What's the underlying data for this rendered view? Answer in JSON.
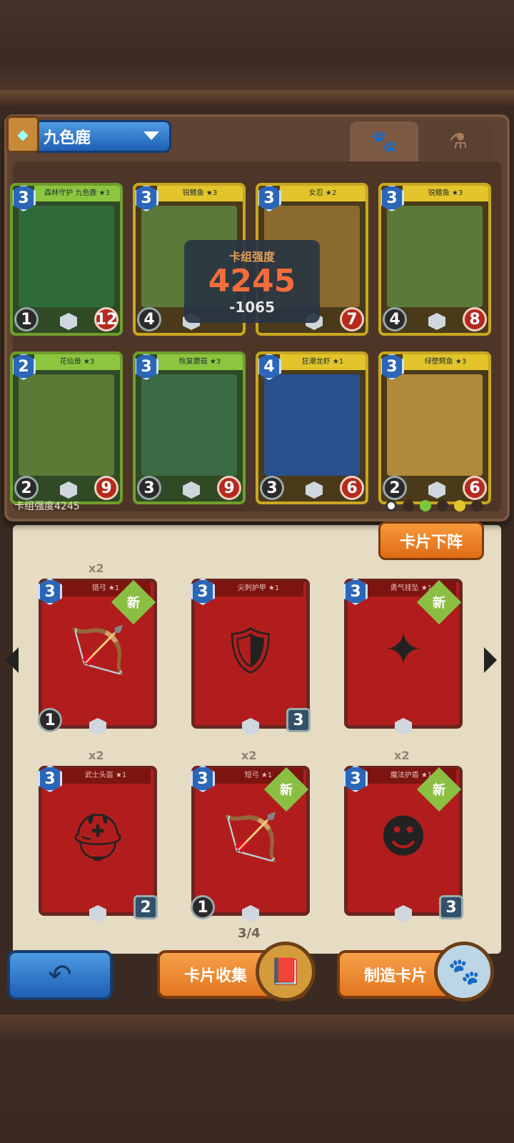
{
  "deck": {
    "name": "九色鹿",
    "power_footer": "卡组强度4245",
    "power_popup": {
      "label": "卡组强度",
      "value": "4245",
      "delta": "-1065"
    }
  },
  "tabs": [
    "paw-icon",
    "potion-icon"
  ],
  "deck_cards": [
    {
      "title": "森林守护 九色鹿 ★3",
      "cost": "3",
      "attack": "1",
      "health": "12",
      "frame": "green",
      "art": "#2f6b3a"
    },
    {
      "title": "锐鳍鱼 ★3",
      "cost": "3",
      "attack": "4",
      "health": "",
      "frame": "gold",
      "art": "#5b7a3a"
    },
    {
      "title": "女忍 ★2",
      "cost": "3",
      "attack": "",
      "health": "7",
      "frame": "gold",
      "art": "#8a6a2e"
    },
    {
      "title": "锐鳍鱼 ★3",
      "cost": "3",
      "attack": "4",
      "health": "8",
      "frame": "gold",
      "art": "#5b7a3a"
    },
    {
      "title": "花仙兽 ★3",
      "cost": "2",
      "attack": "2",
      "health": "9",
      "frame": "green",
      "art": "#5a7a35"
    },
    {
      "title": "恢复蘑菇 ★3",
      "cost": "3",
      "attack": "3",
      "health": "9",
      "frame": "green",
      "art": "#3b6a45"
    },
    {
      "title": "狂潮龙虾 ★1",
      "cost": "4",
      "attack": "3",
      "health": "6",
      "frame": "gold",
      "art": "#2a4f8f"
    },
    {
      "title": "绿壁鳄鱼 ★3",
      "cost": "3",
      "attack": "2",
      "health": "6",
      "frame": "gold",
      "art": "#b08a3a"
    }
  ],
  "remove_button": "卡片下阵",
  "collection_cards": [
    {
      "title": "猎弓 ★1",
      "cost": "3",
      "count": "x2",
      "new": "新",
      "attack": "1",
      "armor": "",
      "art_icon": "🏹"
    },
    {
      "title": "尖刺护甲 ★1",
      "cost": "3",
      "count": "",
      "new": "",
      "attack": "",
      "armor": "3",
      "art_icon": "🛡"
    },
    {
      "title": "勇气挂坠 ★1",
      "cost": "3",
      "count": "",
      "new": "新",
      "attack": "",
      "armor": "",
      "art_icon": "✦"
    },
    {
      "title": "武士头盔 ★1",
      "cost": "3",
      "count": "x2",
      "new": "",
      "attack": "",
      "armor": "2",
      "art_icon": "⛑"
    },
    {
      "title": "短弓 ★1",
      "cost": "3",
      "count": "x2",
      "new": "新",
      "attack": "1",
      "armor": "",
      "art_icon": "🏹"
    },
    {
      "title": "魔法护盾 ★1",
      "cost": "3",
      "count": "x2",
      "new": "新",
      "attack": "",
      "armor": "3",
      "art_icon": "☻"
    }
  ],
  "page_indicator": "3/4",
  "bottom": {
    "collect": "卡片收集",
    "craft": "制造卡片"
  }
}
